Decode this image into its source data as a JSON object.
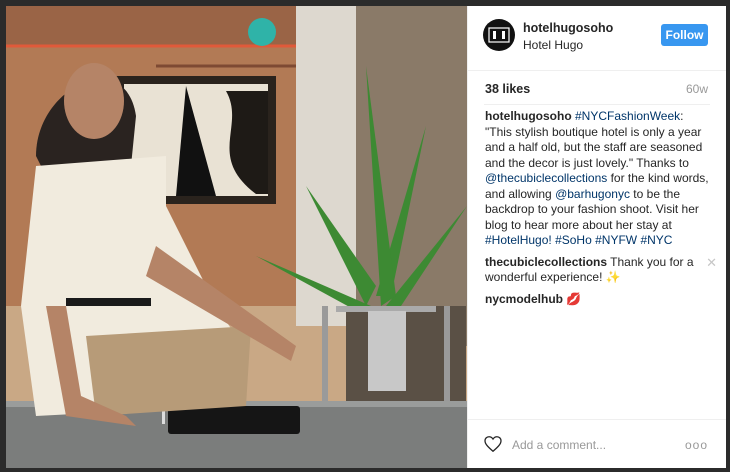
{
  "post": {
    "username": "hotelhugosoho",
    "location": "Hotel Hugo",
    "follow_label": "Follow",
    "likes": "38 likes",
    "age": "60w"
  },
  "caption": {
    "user": "hotelhugosoho",
    "hashtag1": "#NYCFashionWeek",
    "text1": ": \"This stylish boutique hotel is only a year and a half old, but the staff are seasoned and the decor is just lovely.\" Thanks to ",
    "mention1": "@thecubiclecollections",
    "text2": " for the kind words, and allowing ",
    "mention2": "@barhugonyc",
    "text3": " to be the backdrop to your fashion shoot. Visit her blog to hear more about her stay at ",
    "hashtags": [
      "#HotelHugo!",
      "#SoHo",
      "#NYFW",
      "#NYC"
    ]
  },
  "comments": [
    {
      "user": "thecubiclecollections",
      "text": "Thank you for a wonderful experience! ✨"
    },
    {
      "user": "nycmodelhub",
      "text": "💋"
    }
  ],
  "add_comment_placeholder": "Add a comment...",
  "more_label": "ooo",
  "colors": {
    "follow": "#3897f0",
    "link": "#003569"
  },
  "icons": {
    "heart": "heart-icon",
    "logo": "hotel-logo-icon",
    "close": "close-icon"
  }
}
